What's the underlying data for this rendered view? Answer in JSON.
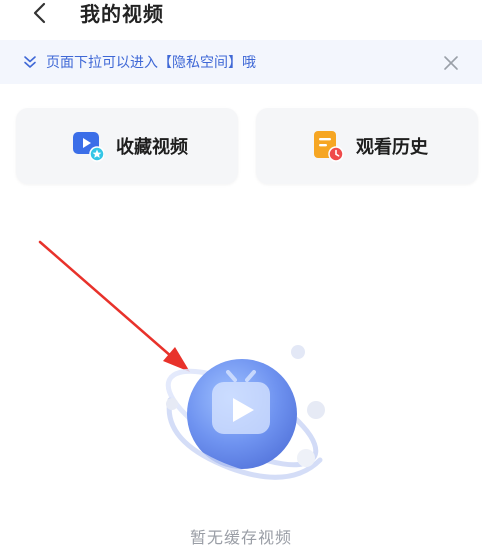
{
  "header": {
    "title": "我的视频"
  },
  "hint": {
    "text": "页面下拉可以进入【隐私空间】哦"
  },
  "cards": {
    "favorites_label": "收藏视频",
    "history_label": "观看历史"
  },
  "empty_state": {
    "text": "暂无缓存视频"
  },
  "icons": {
    "back": "chevron-left-icon",
    "hint": "double-chevron-down-icon",
    "close": "close-icon",
    "favorites": "video-star-icon",
    "history": "history-note-icon",
    "empty": "tv-play-planet-icon"
  },
  "colors": {
    "accent_blue": "#3f68d6",
    "banner_bg": "#f3f6fd",
    "card_bg": "#f5f6f8",
    "history_orange": "#f6a623",
    "history_red": "#ef4b4b",
    "annotation_red": "#e8322b",
    "empty_text": "#9a9ea6"
  }
}
